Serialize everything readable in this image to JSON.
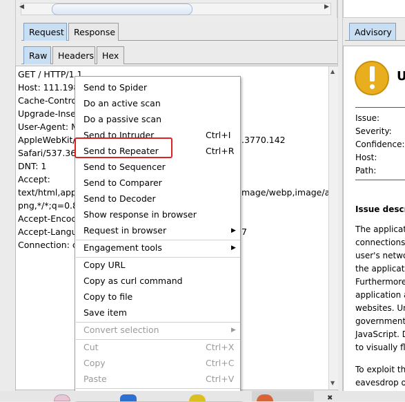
{
  "colors": {
    "active_tab": "#c8dff3",
    "highlight_border": "#e02020",
    "warning_icon": "#e9ae1e"
  },
  "tabs_top": {
    "request": "Request",
    "response": "Response"
  },
  "tabs_sub": {
    "raw": "Raw",
    "headers": "Headers",
    "hex": "Hex"
  },
  "advisory_tab": "Advisory",
  "request_lines": [
    "GET / HTTP/1.1",
    "Host: 111.198",
    "Cache-Control",
    "Upgrade-Insec",
    "User-Agent: M",
    "AppleWebKit/",
    "Safari/537.36",
    "DNT: 1",
    "Accept:",
    "text/html,appli",
    "png,*/*;q=0.8,",
    "Accept-Encod",
    "Accept-Langu",
    "Connection: cl"
  ],
  "request_right_fragments": {
    "applewebkit_tail": ".3770.142",
    "accept_tail": "mage/webp,image/a",
    "lang_tail": "7"
  },
  "context_menu": {
    "items": [
      {
        "label": "Send to Spider",
        "shortcut": ""
      },
      {
        "label": "Do an active scan",
        "shortcut": ""
      },
      {
        "label": "Do a passive scan",
        "shortcut": ""
      },
      {
        "label": "Send to Intruder",
        "shortcut": "Ctrl+I"
      },
      {
        "label": "Send to Repeater",
        "shortcut": "Ctrl+R"
      },
      {
        "label": "Send to Sequencer",
        "shortcut": ""
      },
      {
        "label": "Send to Comparer",
        "shortcut": ""
      },
      {
        "label": "Send to Decoder",
        "shortcut": ""
      },
      {
        "label": "Show response in browser",
        "shortcut": ""
      },
      {
        "label": "Request in browser",
        "shortcut": ""
      },
      {
        "label": "Engagement tools",
        "shortcut": ""
      },
      {
        "label": "Copy URL",
        "shortcut": ""
      },
      {
        "label": "Copy as curl command",
        "shortcut": ""
      },
      {
        "label": "Copy to file",
        "shortcut": ""
      },
      {
        "label": "Save item",
        "shortcut": ""
      },
      {
        "label": "Convert selection",
        "shortcut": ""
      },
      {
        "label": "Cut",
        "shortcut": "Ctrl+X"
      },
      {
        "label": "Copy",
        "shortcut": "Ctrl+C"
      },
      {
        "label": "Paste",
        "shortcut": "Ctrl+V"
      }
    ]
  },
  "advisory": {
    "title": "U",
    "fields": [
      "Issue:",
      "Severity:",
      "Confidence:",
      "Host:",
      "Path:"
    ],
    "description_title": "Issue descri",
    "description_lines": [
      "The applicatio",
      "connections.",
      "user's networ",
      "the applicatio",
      "Furthermore,",
      "application a",
      "websites. Un",
      "governments",
      "JavaScript. D",
      "to visually fla",
      "",
      "To exploit th",
      "eavesdrop or"
    ]
  }
}
